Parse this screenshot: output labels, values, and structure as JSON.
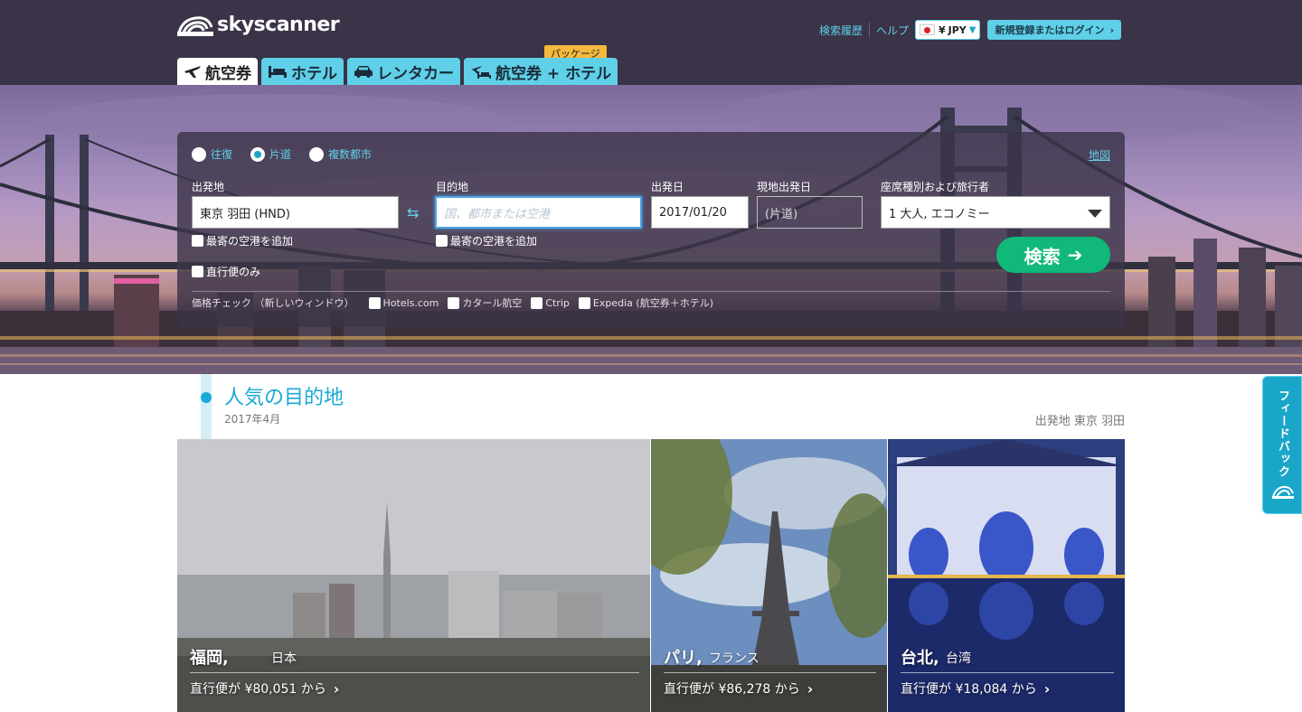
{
  "header": {
    "logo_text": "skyscanner",
    "links": {
      "history": "検索履歴",
      "help": "ヘルプ"
    },
    "currency": {
      "symbol": "¥",
      "code": "JPY",
      "flag": "japan-flag"
    },
    "login_label": "新規登録またはログイン",
    "tabs": [
      {
        "label": "航空券",
        "icon": "plane-icon",
        "active": true
      },
      {
        "label": "ホテル",
        "icon": "bed-icon",
        "active": false
      },
      {
        "label": "レンタカー",
        "icon": "car-icon",
        "active": false
      },
      {
        "label": "航空券 + ホテル",
        "icon": "plane-hotel-icon",
        "active": false
      }
    ],
    "package_badge": "パッケージ"
  },
  "search": {
    "trip_types": [
      {
        "label": "往復",
        "checked": false
      },
      {
        "label": "片道",
        "checked": true
      },
      {
        "label": "複数都市",
        "checked": false
      }
    ],
    "map_link": "地図",
    "origin": {
      "label": "出発地",
      "value": "東京 羽田 (HND)",
      "nearby_label": "最寄の空港を追加"
    },
    "destination": {
      "label": "目的地",
      "placeholder": "国、都市または空港",
      "nearby_label": "最寄の空港を追加"
    },
    "depart": {
      "label": "出発日",
      "value": "2017/01/20"
    },
    "return": {
      "label": "現地出発日",
      "value": "(片道)"
    },
    "cabin": {
      "label": "座席種別および旅行者",
      "value": "1 大人, エコノミー"
    },
    "direct_only_label": "直行便のみ",
    "search_button": "検索",
    "price_check": {
      "label": "価格チェック （新しいウィンドウ）",
      "options": [
        "Hotels.com",
        "カタール航空",
        "Ctrip",
        "Expedia (航空券＋ホテル)"
      ]
    }
  },
  "popular": {
    "title": "人気の目的地",
    "date": "2017年4月",
    "origin_label": "出発地 東京 羽田",
    "cards": [
      {
        "city": "福岡,",
        "country": "日本",
        "price": "直行便が ¥80,051 から"
      },
      {
        "city": "パリ,",
        "country": "フランス",
        "price": "直行便が ¥86,278 から"
      },
      {
        "city": "台北,",
        "country": "台湾",
        "price": "直行便が ¥18,084 から"
      }
    ]
  },
  "feedback_label": "フィードバック",
  "colors": {
    "header_bg": "#3b3347",
    "accent": "#5fd0e8",
    "search_green": "#10b879",
    "title_blue": "#19a9d5",
    "badge_yellow": "#f5b83d"
  }
}
